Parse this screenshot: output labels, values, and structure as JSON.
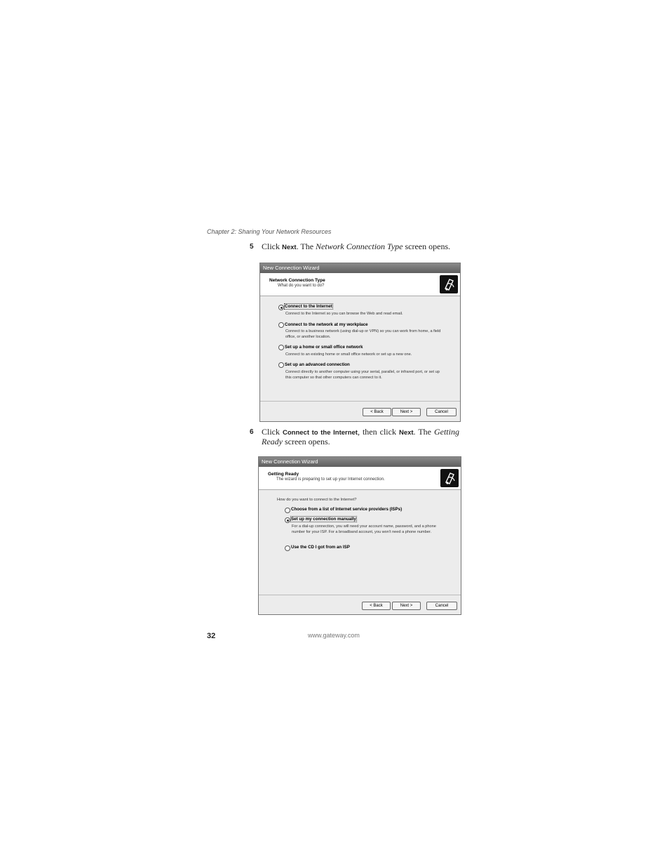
{
  "header": {
    "chapter": "Chapter 2: Sharing Your Network Resources"
  },
  "steps": [
    {
      "number": "5",
      "t1": "Click ",
      "ui1": "Next",
      "t2": ". The ",
      "em1": "Network Connection Type",
      "t3": " screen opens."
    },
    {
      "number": "6",
      "t1": "Click ",
      "ui1": "Connect to the Internet",
      "t2": ", then click ",
      "ui2": "Next",
      "t3": ". The ",
      "em1": "Getting Ready",
      "t4": " screen opens."
    }
  ],
  "wizard1": {
    "title": "New Connection Wizard",
    "heading": "Network Connection Type",
    "subheading": "What do you want to do?",
    "options": [
      {
        "label": "Connect to the Internet",
        "desc": "Connect to the Internet so you can browse the Web and read email.",
        "selected": true
      },
      {
        "label": "Connect to the network at my workplace",
        "desc": "Connect to a business network (using dial-up or VPN) so you can work from home, a field office, or another location.",
        "selected": false
      },
      {
        "label": "Set up a home or small office network",
        "desc": "Connect to an existing home or small office network or set up a new one.",
        "selected": false
      },
      {
        "label": "Set up an advanced connection",
        "desc": "Connect directly to another computer using your serial, parallel, or infrared port, or set up this computer so that other computers can connect to it.",
        "selected": false
      }
    ],
    "buttons": {
      "back": "< Back",
      "next": "Next >",
      "cancel": "Cancel"
    }
  },
  "wizard2": {
    "title": "New Connection Wizard",
    "heading": "Getting Ready",
    "subheading": "The wizard is preparing to set up your Internet connection.",
    "question": "How do you want to connect to the Internet?",
    "options": [
      {
        "label": "Choose from a list of Internet service providers (ISPs)",
        "desc": "",
        "selected": false
      },
      {
        "label": "Set up my connection manually",
        "desc": "For a dial-up connection, you will need your account name, password, and a phone number for your ISP. For a broadband account, you won't need a phone number.",
        "selected": true
      },
      {
        "label": "Use the CD I got from an ISP",
        "desc": "",
        "selected": false
      }
    ],
    "buttons": {
      "back": "< Back",
      "next": "Next >",
      "cancel": "Cancel"
    }
  },
  "footer": {
    "page_number": "32",
    "url": "www.gateway.com"
  }
}
